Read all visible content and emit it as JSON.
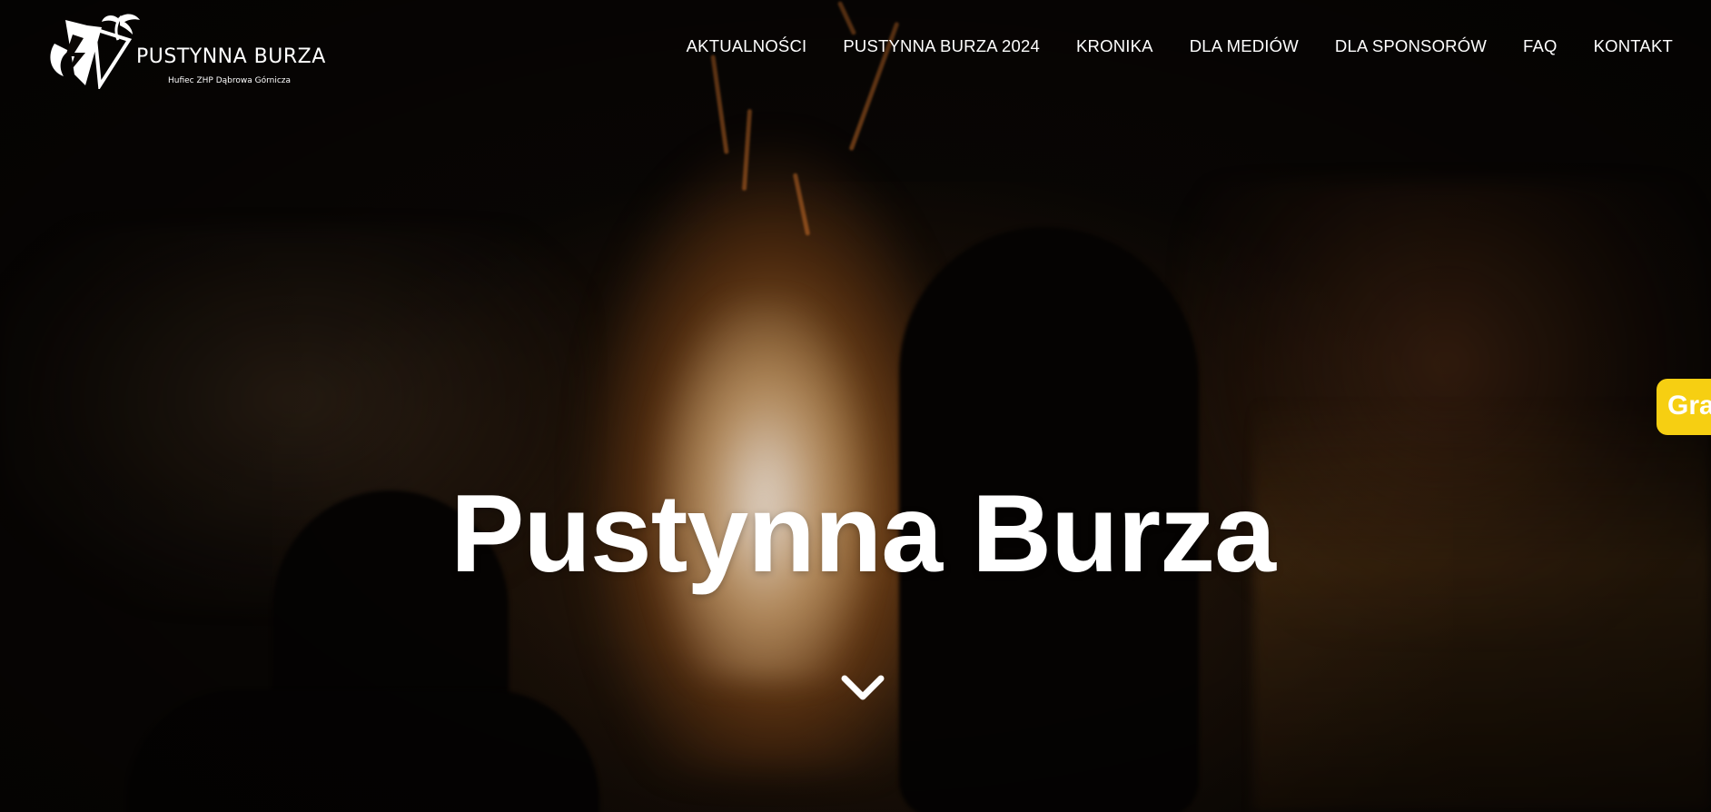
{
  "logo": {
    "title": "PUSTYNNA BURZA",
    "subtitle": "Hufiec ZHP Dąbrowa Górnicza",
    "icon": "scout-lily-palm-logo-icon"
  },
  "nav": {
    "items": [
      {
        "label": "AKTUALNOŚCI"
      },
      {
        "label": "PUSTYNNA BURZA 2024"
      },
      {
        "label": "KRONIKA"
      },
      {
        "label": "DLA MEDIÓW"
      },
      {
        "label": "DLA SPONSORÓW"
      },
      {
        "label": "FAQ"
      },
      {
        "label": "KONTAKT"
      }
    ]
  },
  "hero": {
    "title": "Pustynna Burza",
    "scroll_icon": "chevron-down-icon"
  },
  "side_tab": {
    "label": "Gra"
  },
  "colors": {
    "nav_text": "#ffffff",
    "side_tab_bg": "#f6cf12",
    "background": "#090604"
  }
}
